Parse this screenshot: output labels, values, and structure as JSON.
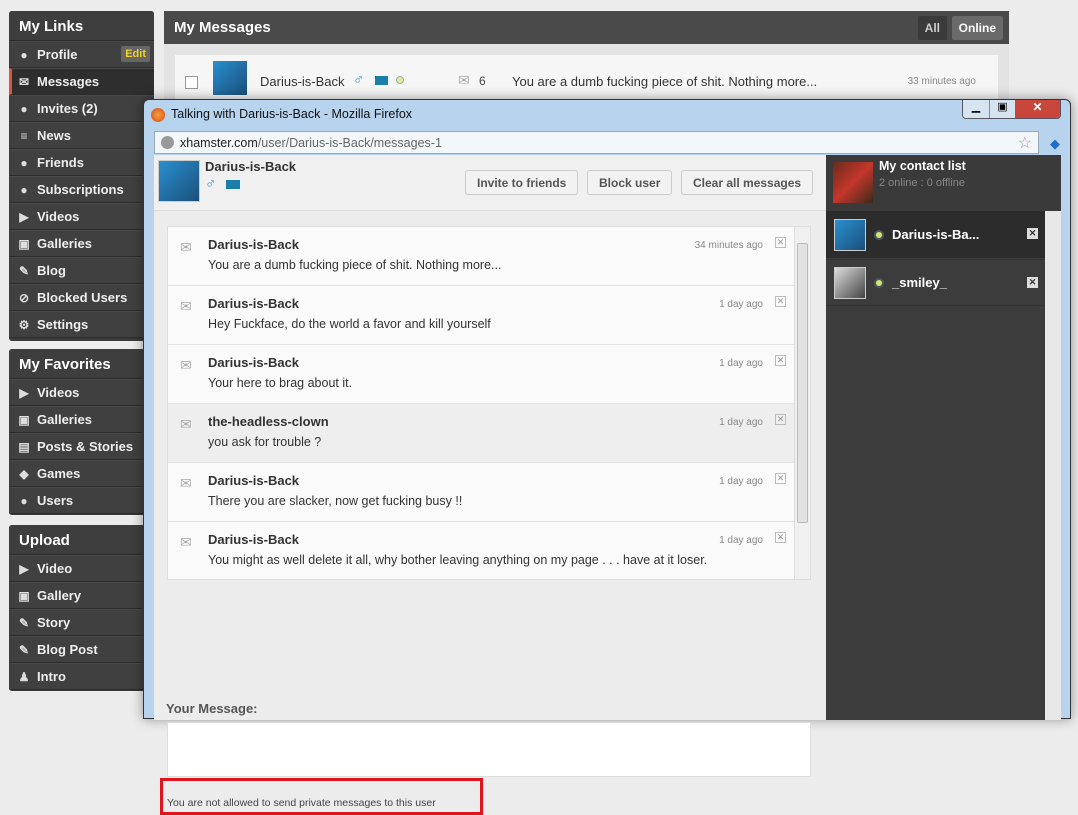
{
  "sidebar": {
    "my_links": {
      "title": "My Links",
      "edit_label": "Edit",
      "items": [
        {
          "label": "Profile",
          "icon": "user-icon"
        },
        {
          "label": "Messages",
          "icon": "envelope-icon"
        },
        {
          "label": "Invites (2)",
          "icon": "users-icon"
        },
        {
          "label": "News",
          "icon": "news-icon"
        },
        {
          "label": "Friends",
          "icon": "friends-icon"
        },
        {
          "label": "Subscriptions",
          "icon": "subscription-icon"
        },
        {
          "label": "Videos",
          "icon": "video-icon"
        },
        {
          "label": "Galleries",
          "icon": "gallery-icon"
        },
        {
          "label": "Blog",
          "icon": "blog-icon"
        },
        {
          "label": "Blocked Users",
          "icon": "block-icon"
        },
        {
          "label": "Settings",
          "icon": "gear-icon"
        }
      ]
    },
    "my_favorites": {
      "title": "My Favorites",
      "items": [
        {
          "label": "Videos"
        },
        {
          "label": "Galleries"
        },
        {
          "label": "Posts & Stories"
        },
        {
          "label": "Games"
        },
        {
          "label": "Users"
        }
      ]
    },
    "upload": {
      "title": "Upload",
      "items": [
        {
          "label": "Video"
        },
        {
          "label": "Gallery"
        },
        {
          "label": "Story"
        },
        {
          "label": "Blog Post"
        },
        {
          "label": "Intro"
        }
      ]
    }
  },
  "main": {
    "title": "My Messages",
    "filter_all": "All",
    "filter_online": "Online",
    "row": {
      "user": "Darius-is-Back",
      "count": "6",
      "preview": "You are a dumb fucking piece of shit. Nothing more...",
      "time": "33 minutes ago"
    }
  },
  "window": {
    "title": "Talking with Darius-is-Back - Mozilla Firefox",
    "url_domain": "xhamster.com",
    "url_path": "/user/Darius-is-Back/messages-1",
    "user": "Darius-is-Back",
    "invite": "Invite to friends",
    "block": "Block user",
    "clear": "Clear all messages",
    "messages": [
      {
        "name": "Darius-is-Back",
        "text": "You are a dumb fucking piece of shit. Nothing more...",
        "time": "34 minutes ago"
      },
      {
        "name": "Darius-is-Back",
        "text": "Hey Fuckface, do the world a favor and kill yourself",
        "time": "1 day ago"
      },
      {
        "name": "Darius-is-Back",
        "text": "Your here to brag about it.",
        "time": "1 day ago"
      },
      {
        "name": "the-headless-clown",
        "text": "you ask for trouble ?",
        "time": "1 day ago"
      },
      {
        "name": "Darius-is-Back",
        "text": "There you are slacker, now get fucking busy !!",
        "time": "1 day ago"
      },
      {
        "name": "Darius-is-Back",
        "text": "You might as well delete it all, why bother leaving anything on my page . . . have at it loser.",
        "time": "1 day ago"
      }
    ],
    "your_message_label": "Your Message:",
    "message_value": "",
    "error": "You are not allowed to send private messages to this user",
    "contacts": {
      "title": "My contact list",
      "status": "2 online : 0 offline",
      "items": [
        {
          "name": "Darius-is-Ba..."
        },
        {
          "name": "_smiley_"
        }
      ]
    }
  },
  "colors": {
    "accent": "#d9553b",
    "error_border": "#e0141e",
    "online": "#c7e87a"
  }
}
